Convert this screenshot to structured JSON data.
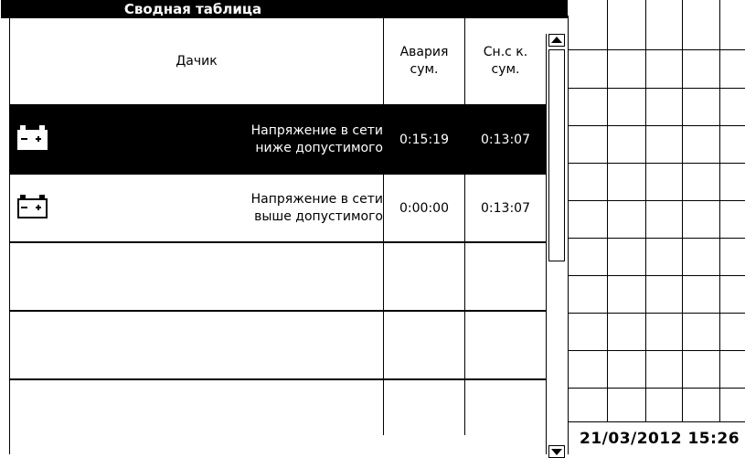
{
  "title": "Сводная таблица",
  "columns": {
    "sensor": "Дачик",
    "alarm_sum": "Авария сум.",
    "snsk_sum": "Сн.с к. сум."
  },
  "alarm_sum_lines": [
    "Авария",
    "сум."
  ],
  "snsk_sum_lines": [
    "Сн.с к.",
    "сум."
  ],
  "rows": [
    {
      "icon": "battery-icon",
      "name_lines": [
        "Напряжение в сети",
        "ниже допустимого"
      ],
      "alarm_sum": "0:15:19",
      "snsk_sum": "0:13:07",
      "selected": true
    },
    {
      "icon": "battery-icon",
      "name_lines": [
        "Напряжение в сети",
        "выше допустимого"
      ],
      "alarm_sum": "0:00:00",
      "snsk_sum": "0:13:07",
      "selected": false
    },
    {
      "icon": "",
      "name_lines": [
        "",
        ""
      ],
      "alarm_sum": "",
      "snsk_sum": "",
      "selected": false
    },
    {
      "icon": "",
      "name_lines": [
        "",
        ""
      ],
      "alarm_sum": "",
      "snsk_sum": "",
      "selected": false
    },
    {
      "icon": "",
      "name_lines": [
        "",
        ""
      ],
      "alarm_sum": "",
      "snsk_sum": "",
      "selected": false
    }
  ],
  "datetime": "21/03/2012 15:26"
}
